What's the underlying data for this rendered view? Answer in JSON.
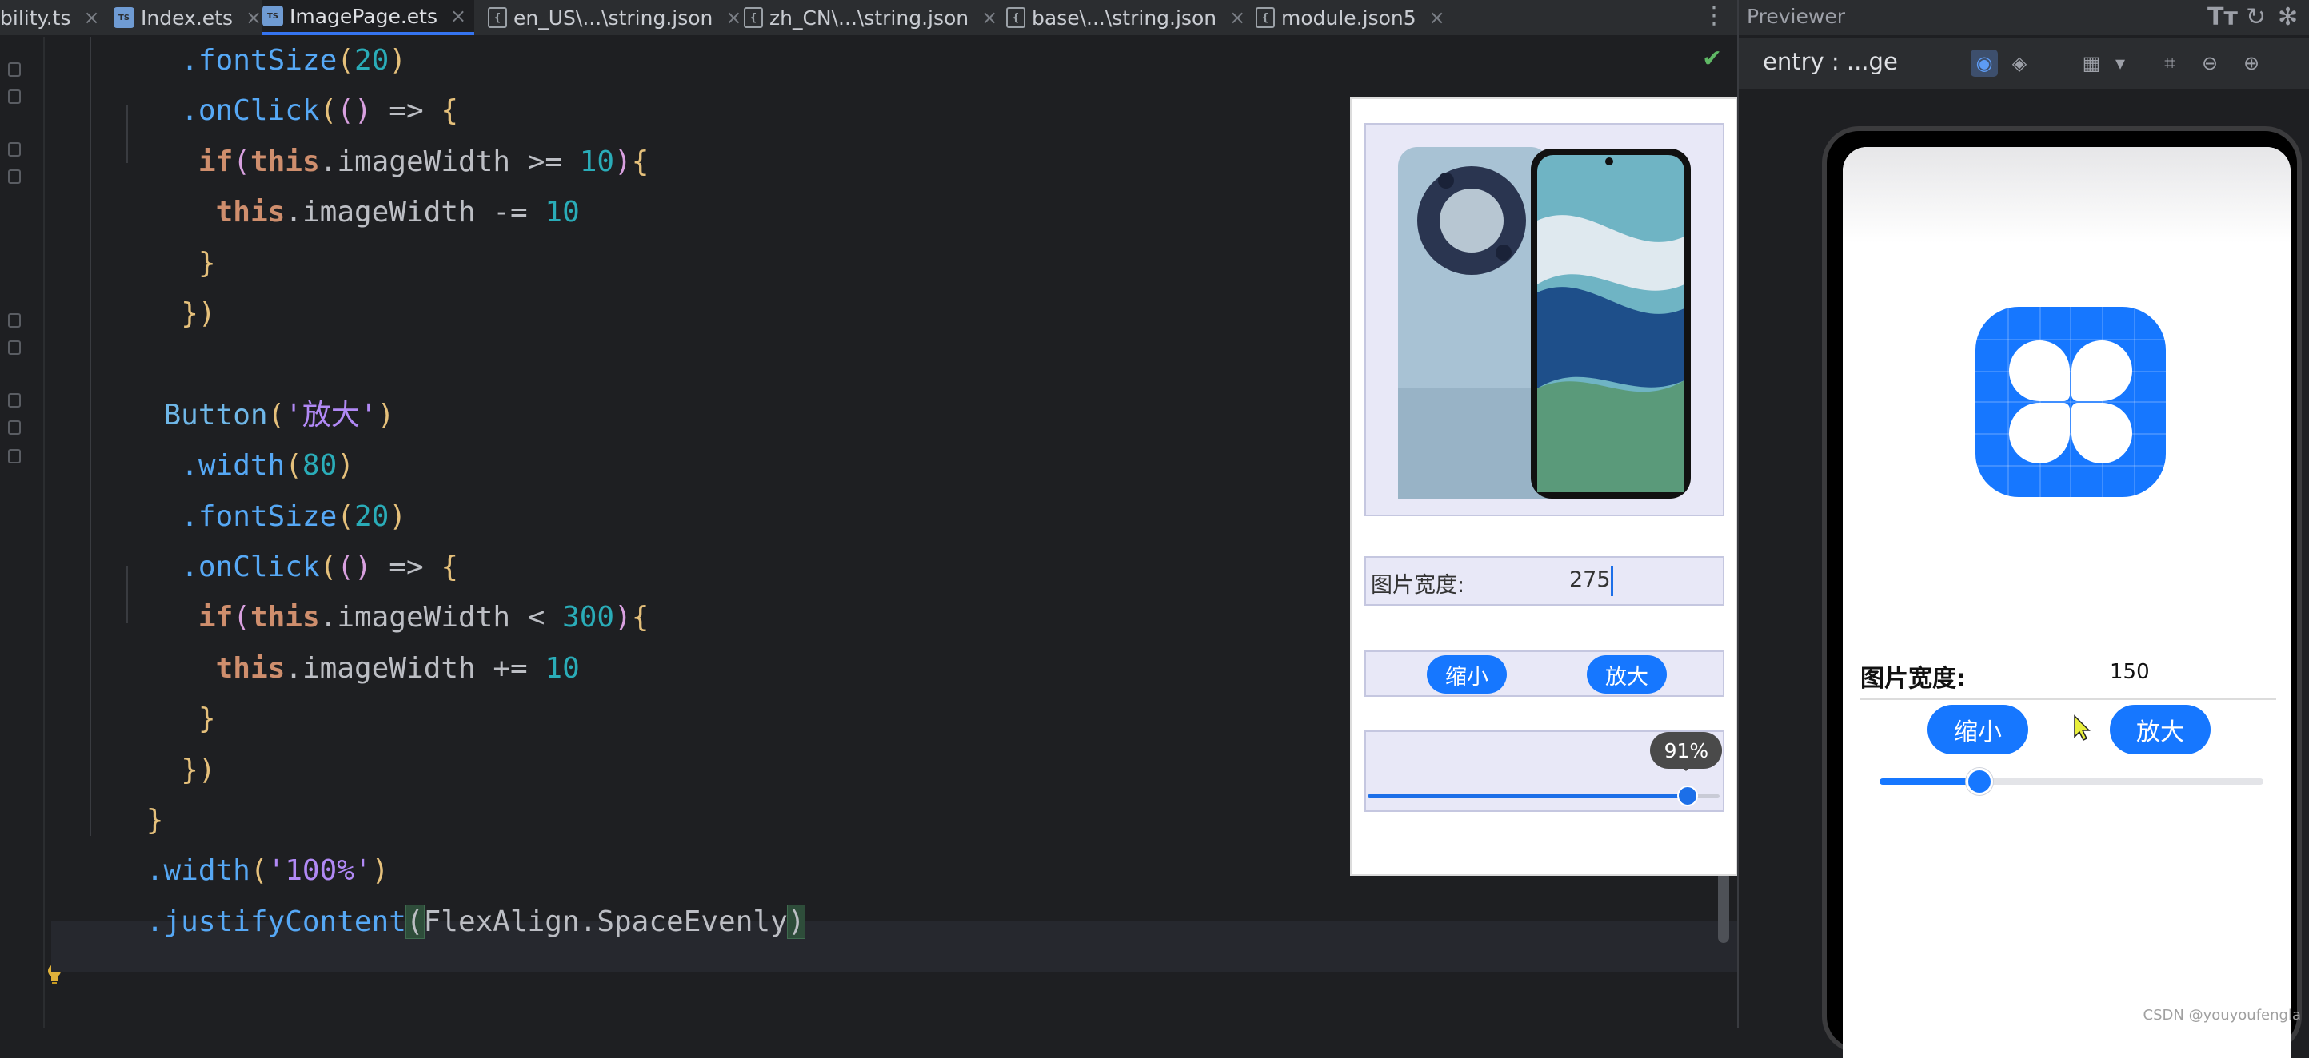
{
  "tabs": [
    {
      "label": "bility.ts",
      "icon": "ts-file-icon"
    },
    {
      "label": "Index.ets",
      "icon": "ets-file-icon"
    },
    {
      "label": "ImagePage.ets",
      "icon": "ets-file-icon",
      "active": true
    },
    {
      "label": "en_US\\...\\string.json",
      "icon": "json-file-icon"
    },
    {
      "label": "zh_CN\\...\\string.json",
      "icon": "json-file-icon"
    },
    {
      "label": "base\\...\\string.json",
      "icon": "json-file-icon"
    },
    {
      "label": "module.json5",
      "icon": "json-file-icon"
    }
  ],
  "code_lines": [
    {
      "indent": 6,
      "segments": [
        {
          "t": ".fontSize",
          "c": "fn"
        },
        {
          "t": "(",
          "c": "br1"
        },
        {
          "t": "20",
          "c": "num"
        },
        {
          "t": ")",
          "c": "br1"
        }
      ]
    },
    {
      "indent": 6,
      "segments": [
        {
          "t": ".onClick",
          "c": "fn"
        },
        {
          "t": "(",
          "c": "br1"
        },
        {
          "t": "() ",
          "c": "br2"
        },
        {
          "t": "=> ",
          "c": "op"
        },
        {
          "t": "{",
          "c": "br1"
        }
      ]
    },
    {
      "indent": 7,
      "segments": [
        {
          "t": "if",
          "c": "k"
        },
        {
          "t": "(",
          "c": "br2"
        },
        {
          "t": "this",
          "c": "k"
        },
        {
          "t": ".imageWidth >= ",
          "c": "op"
        },
        {
          "t": "10",
          "c": "num"
        },
        {
          "t": ")",
          "c": "br2"
        },
        {
          "t": "{",
          "c": "br1"
        }
      ]
    },
    {
      "indent": 8,
      "segments": [
        {
          "t": "this",
          "c": "k"
        },
        {
          "t": ".imageWidth -= ",
          "c": "op"
        },
        {
          "t": "10",
          "c": "num"
        }
      ]
    },
    {
      "indent": 7,
      "segments": [
        {
          "t": "}",
          "c": "br1"
        }
      ]
    },
    {
      "indent": 6,
      "segments": [
        {
          "t": "})",
          "c": "br1"
        }
      ]
    },
    {
      "indent": 0,
      "segments": []
    },
    {
      "indent": 5,
      "segments": [
        {
          "t": "Button",
          "c": "cp"
        },
        {
          "t": "(",
          "c": "br1"
        },
        {
          "t": "'放大'",
          "c": "strc"
        },
        {
          "t": ")",
          "c": "br1"
        }
      ]
    },
    {
      "indent": 6,
      "segments": [
        {
          "t": ".width",
          "c": "fn"
        },
        {
          "t": "(",
          "c": "br1"
        },
        {
          "t": "80",
          "c": "num"
        },
        {
          "t": ")",
          "c": "br1"
        }
      ]
    },
    {
      "indent": 6,
      "segments": [
        {
          "t": ".fontSize",
          "c": "fn"
        },
        {
          "t": "(",
          "c": "br1"
        },
        {
          "t": "20",
          "c": "num"
        },
        {
          "t": ")",
          "c": "br1"
        }
      ]
    },
    {
      "indent": 6,
      "segments": [
        {
          "t": ".onClick",
          "c": "fn"
        },
        {
          "t": "(",
          "c": "br1"
        },
        {
          "t": "() ",
          "c": "br2"
        },
        {
          "t": "=> ",
          "c": "op"
        },
        {
          "t": "{",
          "c": "br1"
        }
      ]
    },
    {
      "indent": 7,
      "segments": [
        {
          "t": "if",
          "c": "k"
        },
        {
          "t": "(",
          "c": "br2"
        },
        {
          "t": "this",
          "c": "k"
        },
        {
          "t": ".imageWidth < ",
          "c": "op"
        },
        {
          "t": "300",
          "c": "num"
        },
        {
          "t": ")",
          "c": "br2"
        },
        {
          "t": "{",
          "c": "br1"
        }
      ]
    },
    {
      "indent": 8,
      "segments": [
        {
          "t": "this",
          "c": "k"
        },
        {
          "t": ".imageWidth += ",
          "c": "op"
        },
        {
          "t": "10",
          "c": "num"
        }
      ]
    },
    {
      "indent": 7,
      "segments": [
        {
          "t": "}",
          "c": "br1"
        }
      ]
    },
    {
      "indent": 6,
      "segments": [
        {
          "t": "})",
          "c": "br1"
        }
      ]
    },
    {
      "indent": 4,
      "segments": [
        {
          "t": "}",
          "c": "br1"
        }
      ]
    },
    {
      "indent": 4,
      "segments": [
        {
          "t": ".width",
          "c": "fn"
        },
        {
          "t": "(",
          "c": "br1"
        },
        {
          "t": "'100%'",
          "c": "strc"
        },
        {
          "t": ")",
          "c": "br1"
        }
      ]
    },
    {
      "indent": 4,
      "segments": [
        {
          "t": ".justifyContent",
          "c": "fn"
        },
        {
          "t": "(",
          "c": "hl"
        },
        {
          "t": "FlexAlign.SpaceEvenly",
          "c": "op"
        },
        {
          "t": ")",
          "c": "hl"
        }
      ]
    }
  ],
  "popup": {
    "width_label": "图片宽度:",
    "width_value": "275",
    "shrink_label": "缩小",
    "enlarge_label": "放大",
    "slider_tooltip": "91%",
    "slider_fraction": 0.91
  },
  "previewer": {
    "title": "Previewer",
    "entry_label": "entry : ...ge",
    "screen": {
      "width_label": "图片宽度:",
      "width_value": "150",
      "shrink_label": "缩小",
      "enlarge_label": "放大",
      "slider_fraction": 0.26
    }
  },
  "watermark": "CSDN @youyoufengla",
  "colors": {
    "accent": "#1677ff",
    "editor_bg": "#1e1f22",
    "ok_check": "#5fb865"
  }
}
